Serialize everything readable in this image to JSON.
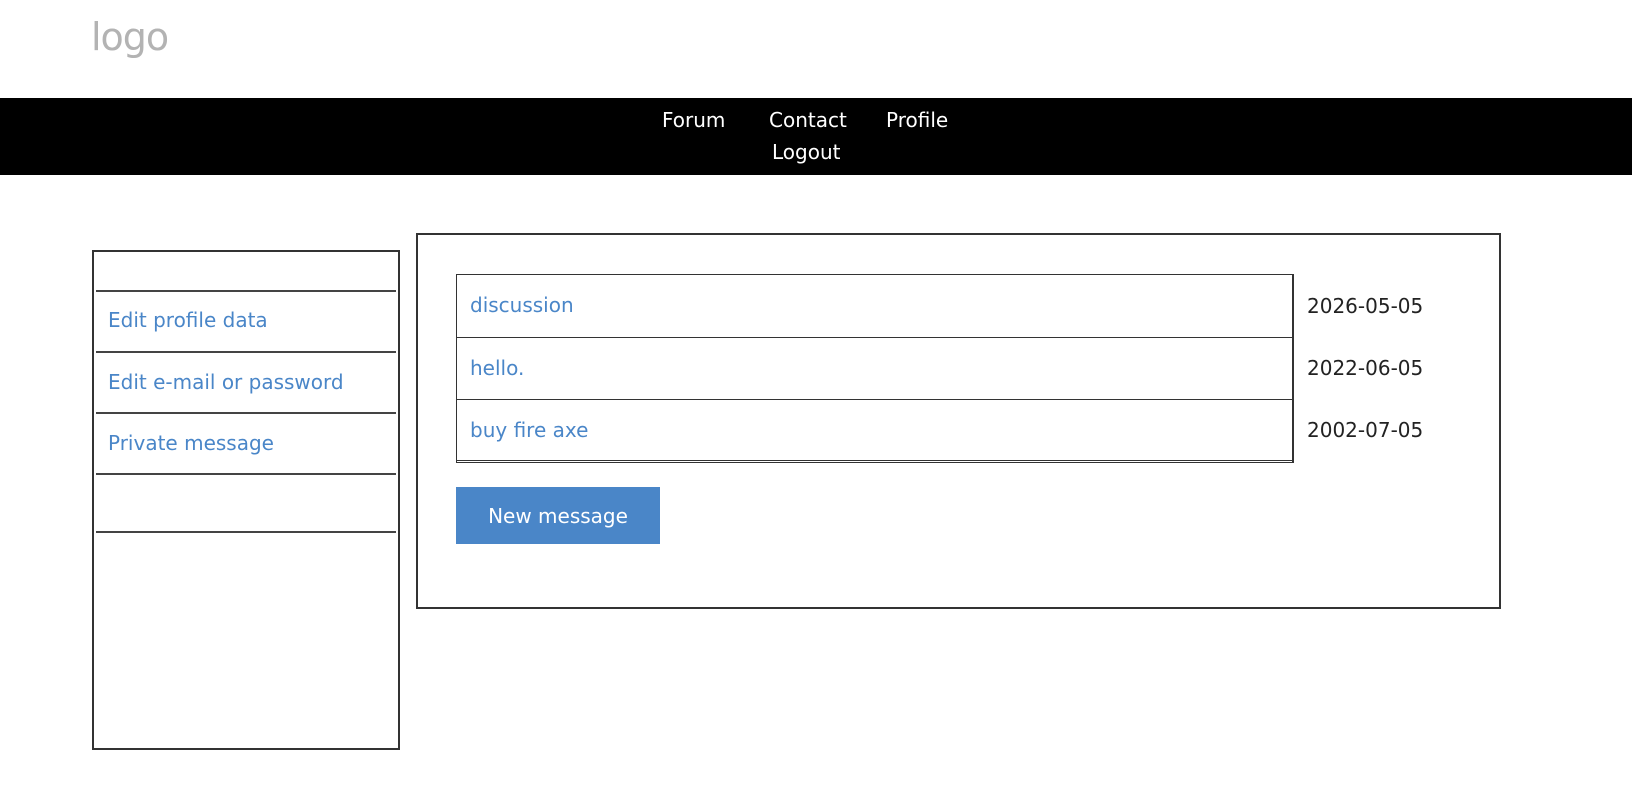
{
  "header": {
    "logo_text": "logo"
  },
  "nav": {
    "items": [
      {
        "label": "Forum"
      },
      {
        "label": "Contact"
      },
      {
        "label": "Profile"
      },
      {
        "label": "Logout"
      }
    ]
  },
  "sidebar": {
    "items": [
      {
        "label": "Edit profile data"
      },
      {
        "label": "Edit e-mail or password"
      },
      {
        "label": "Private message"
      }
    ]
  },
  "messages": [
    {
      "subject": "discussion",
      "date": "2026-05-05"
    },
    {
      "subject": "hello.",
      "date": "2022-06-05"
    },
    {
      "subject": "buy fire axe",
      "date": "2002-07-05"
    }
  ],
  "actions": {
    "new_message_label": "New message"
  },
  "colors": {
    "accent": "#4a86c8",
    "navbar": "#000000",
    "logo": "#b3b3b3"
  }
}
